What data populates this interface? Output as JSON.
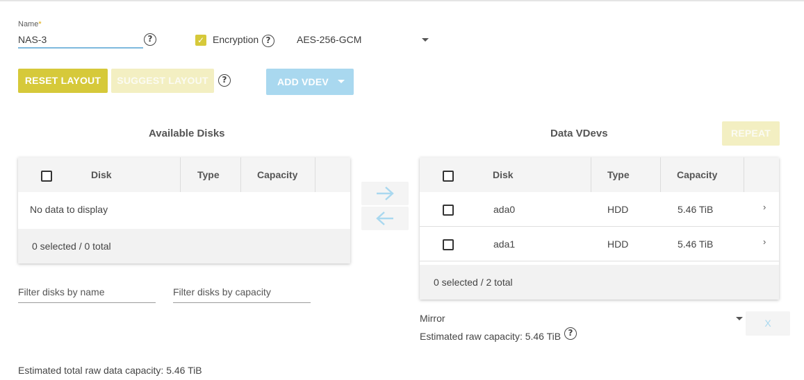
{
  "form": {
    "name_label": "Name",
    "name_required": "*",
    "name_value": "NAS-3",
    "encryption_label": "Encryption",
    "encryption_checked": true,
    "encryption_algorithm": "AES-256-GCM"
  },
  "toolbar": {
    "reset_layout": "RESET LAYOUT",
    "suggest_layout": "SUGGEST LAYOUT",
    "add_vdev": "ADD VDEV"
  },
  "available_disks": {
    "title": "Available Disks",
    "columns": [
      "Disk",
      "Type",
      "Capacity"
    ],
    "empty_message": "No data to display",
    "footer": "0 selected / 0 total",
    "filter_name_placeholder": "Filter disks by name",
    "filter_capacity_placeholder": "Filter disks by capacity"
  },
  "data_vdevs": {
    "title": "Data VDevs",
    "repeat_label": "REPEAT",
    "columns": [
      "Disk",
      "Type",
      "Capacity"
    ],
    "rows": [
      {
        "disk": "ada0",
        "type": "HDD",
        "capacity": "5.46 TiB"
      },
      {
        "disk": "ada1",
        "type": "HDD",
        "capacity": "5.46 TiB"
      }
    ],
    "footer": "0 selected / 2 total",
    "vdev_type": "Mirror",
    "estimated_raw": "Estimated raw capacity: 5.46 TiB",
    "remove_label": "X"
  },
  "summary": {
    "total_raw": "Estimated total raw data capacity: 5.46 TiB"
  },
  "icons": {
    "help": "help-circle-icon",
    "move_right": "arrow-right-icon",
    "move_left": "arrow-left-icon",
    "expand": "chevron-right-icon"
  },
  "colors": {
    "accent_yellow": "#d6c93a",
    "accent_blue": "#a9d8ef"
  }
}
